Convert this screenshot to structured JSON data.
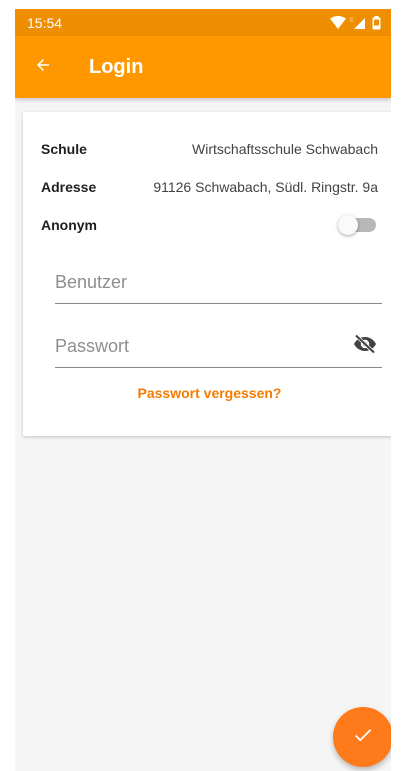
{
  "status_bar": {
    "time": "15:54",
    "icons": [
      "wifi-icon",
      "signal-icon",
      "battery-icon"
    ]
  },
  "app_bar": {
    "title": "Login",
    "back_icon": "arrow-back-icon",
    "color": "#ff9800"
  },
  "school_info": {
    "school_label": "Schule",
    "school_value": "Wirtschaftsschule Schwabach",
    "address_label": "Adresse",
    "address_value": "91126 Schwabach, Südl. Ringstr. 9a",
    "anonymous_label": "Anonym",
    "anonymous_enabled": false
  },
  "form": {
    "username_placeholder": "Benutzer",
    "username_value": "",
    "password_placeholder": "Passwort",
    "password_value": "",
    "password_visibility_icon": "eye-off-icon",
    "forgot_password_label": "Passwort vergessen?"
  },
  "fab": {
    "icon": "check-icon",
    "color": "#ff7a1a"
  }
}
